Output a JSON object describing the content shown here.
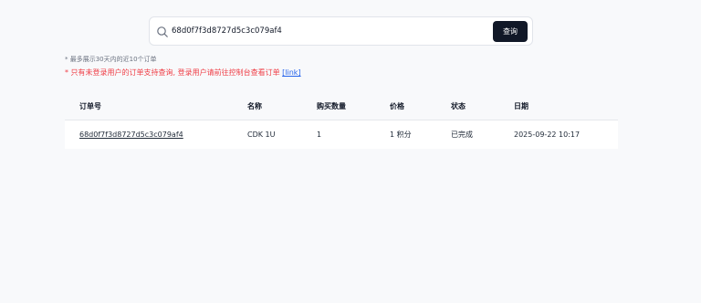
{
  "search": {
    "value": "68d0f7f3d8727d5c3c079af4",
    "button_label": "查询"
  },
  "notes": {
    "recent_limit": "* 最多展示30天内的近10个订单",
    "warning_text": "* 只有未登录用户的订单支持查询, 登录用户请前往控制台查看订单 ",
    "warning_link": "[link]"
  },
  "table": {
    "headers": {
      "order_no": "订单号",
      "name": "名称",
      "quantity": "购买数量",
      "price": "价格",
      "status": "状态",
      "date": "日期"
    },
    "rows": [
      {
        "order_no": "68d0f7f3d8727d5c3c079af4",
        "name": "CDK 1U",
        "quantity": "1",
        "price": "1 积分",
        "status": "已完成",
        "date": "2025-09-22 10:17"
      }
    ]
  }
}
